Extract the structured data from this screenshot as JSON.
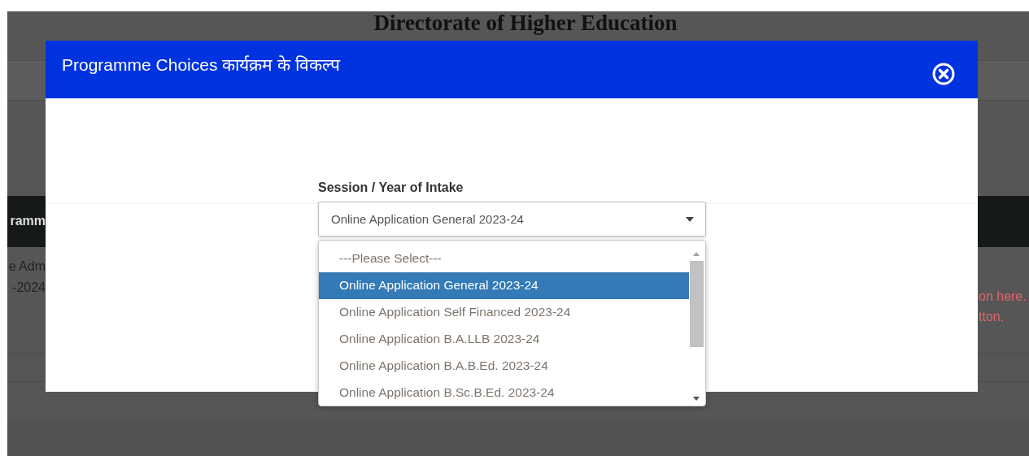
{
  "background_page": {
    "heading": "Directorate of Higher Education",
    "header_fragment": "ramm",
    "left_fragments": [
      "e Adm",
      "-2024"
    ],
    "right_fragments": [
      "on here.",
      "tton."
    ]
  },
  "modal": {
    "title": "Programme Choices कार्यक्रम के विकल्प",
    "field": {
      "label": "Session / Year of Intake",
      "value": "Online Application General 2023-24",
      "expanded": true,
      "options": [
        {
          "label": "---Please Select---",
          "selected": false
        },
        {
          "label": "Online Application General 2023-24",
          "selected": true
        },
        {
          "label": "Online Application Self Financed 2023-24",
          "selected": false
        },
        {
          "label": "Online Application B.A.LLB 2023-24",
          "selected": false
        },
        {
          "label": "Online Application B.A.B.Ed. 2023-24",
          "selected": false
        },
        {
          "label": "Online Application B.Sc.B.Ed. 2023-24",
          "selected": false
        }
      ]
    }
  }
}
